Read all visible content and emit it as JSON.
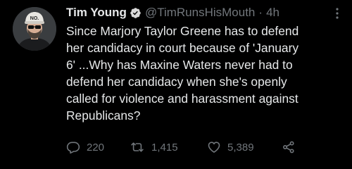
{
  "tweet": {
    "author": {
      "display_name": "Tim Young",
      "handle": "@TimRunsHisMouth",
      "verified": true,
      "verified_icon": "verified-badge-icon",
      "avatar_hat_text": "NO."
    },
    "separator": "·",
    "timestamp": "4h",
    "body_lines": [
      "Since Marjory Taylor Greene has to defend",
      "her candidacy in court because of 'January",
      "6' ...Why has Maxine Waters never had to",
      "defend her candidacy when she's openly",
      "called for violence and harassment against",
      "Republicans?"
    ],
    "stats": {
      "replies": "220",
      "retweets": "1,415",
      "likes": "5,389"
    }
  },
  "colors": {
    "background": "#000000",
    "primary_text": "#e7e9ea",
    "secondary_text": "#71767b",
    "verified_blue": "#1d9bf0"
  }
}
